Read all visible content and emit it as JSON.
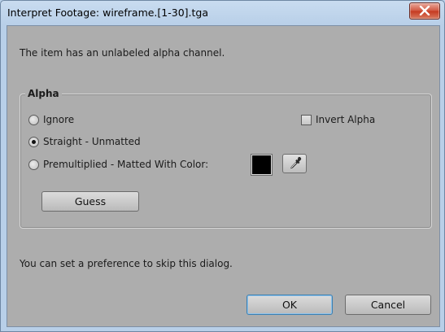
{
  "window": {
    "title": "Interpret Footage: wireframe.[1-30].tga"
  },
  "message": "The item has an unlabeled alpha channel.",
  "alpha_group": {
    "legend": "Alpha",
    "options": [
      {
        "label": "Ignore",
        "checked": false
      },
      {
        "label": "Straight - Unmatted",
        "checked": true
      },
      {
        "label": "Premultiplied - Matted With Color:",
        "checked": false
      }
    ],
    "invert_label": "Invert Alpha",
    "invert_checked": false,
    "matte_color": "#000000",
    "guess_label": "Guess"
  },
  "footer_text": "You can set a preference to skip this dialog.",
  "buttons": {
    "ok": "OK",
    "cancel": "Cancel"
  }
}
